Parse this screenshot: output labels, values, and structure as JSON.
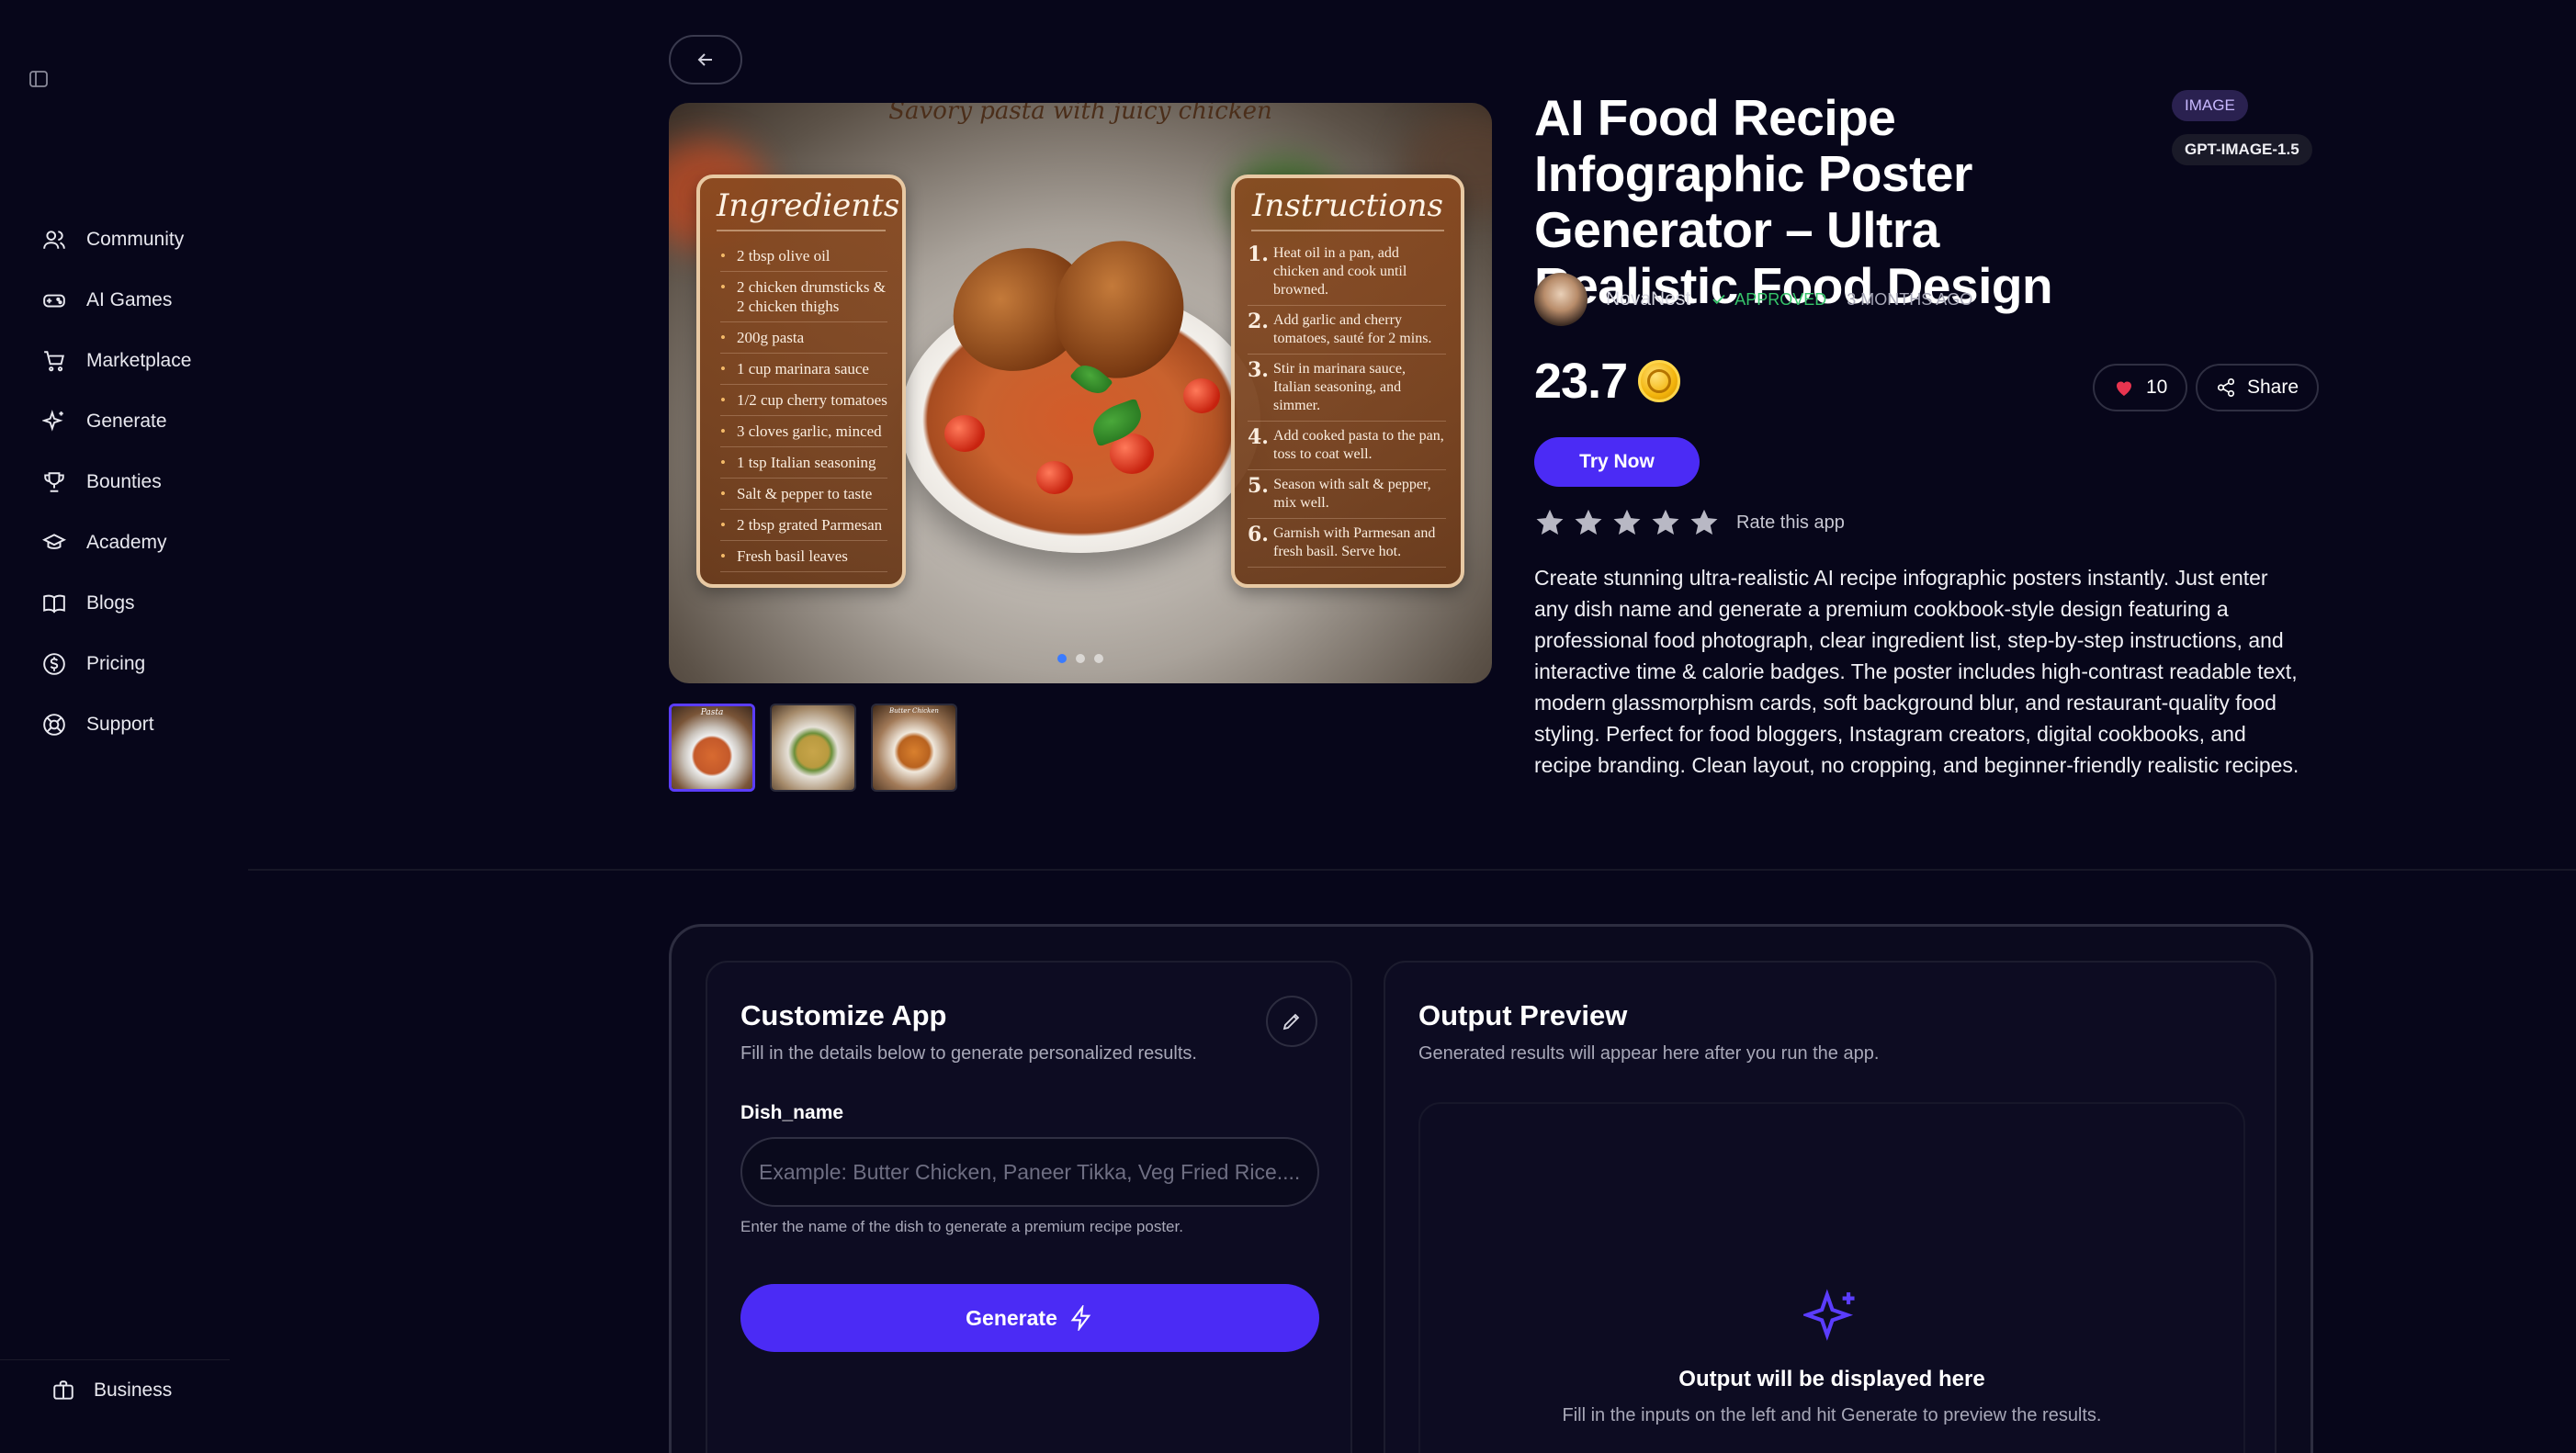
{
  "sidebar": {
    "items": [
      {
        "label": "Community",
        "icon": "users-icon"
      },
      {
        "label": "AI Games",
        "icon": "gamepad-icon"
      },
      {
        "label": "Marketplace",
        "icon": "cart-icon"
      },
      {
        "label": "Generate",
        "icon": "sparkle-icon"
      },
      {
        "label": "Bounties",
        "icon": "trophy-icon"
      },
      {
        "label": "Academy",
        "icon": "graduation-cap-icon"
      },
      {
        "label": "Blogs",
        "icon": "book-icon"
      },
      {
        "label": "Pricing",
        "icon": "dollar-circle-icon"
      },
      {
        "label": "Support",
        "icon": "lifebuoy-icon"
      }
    ],
    "business_label": "Business"
  },
  "poster": {
    "title": "Savory pasta with juicy chicken",
    "ingredients_heading": "Ingredients",
    "ingredients": [
      "2 tbsp olive oil",
      "2 chicken drumsticks & 2 chicken thighs",
      "200g pasta",
      "1 cup marinara sauce",
      "1/2 cup cherry tomatoes",
      "3 cloves garlic, minced",
      "1 tsp Italian seasoning",
      "Salt & pepper to taste",
      "2 tbsp grated Parmesan",
      "Fresh basil leaves"
    ],
    "instructions_heading": "Instructions",
    "instructions": [
      {
        "num": "1.",
        "text": "Heat oil in a pan, add chicken and cook until browned."
      },
      {
        "num": "2.",
        "text": "Add garlic and cherry tomatoes, sauté for 2 mins."
      },
      {
        "num": "3.",
        "text": "Stir in marinara sauce, Italian seasoning, and simmer."
      },
      {
        "num": "4.",
        "text": "Add cooked pasta to the pan, toss to coat well."
      },
      {
        "num": "5.",
        "text": "Season with salt & pepper, mix well."
      },
      {
        "num": "6.",
        "text": "Garnish with Parmesan and fresh basil. Serve hot."
      }
    ],
    "thumb_labels": [
      "Pasta",
      "",
      "Butter Chicken"
    ]
  },
  "app": {
    "title": "AI Food Recipe Infographic Poster Generator – Ultra Realistic Food Design",
    "tags": [
      "IMAGE",
      "GPT-IMAGE-1.5"
    ],
    "author": "NovaNest",
    "status": "APPROVED",
    "age": "3 MONTHS AGO",
    "price": "23.7",
    "likes": "10",
    "share_label": "Share",
    "try_label": "Try Now",
    "rating_stars": 5,
    "rate_label": "Rate this app",
    "description": "Create stunning ultra-realistic AI recipe infographic posters instantly. Just enter any dish name and generate a premium cookbook-style design featuring a professional food photograph, clear ingredient list, step-by-step instructions, and interactive time & calorie badges. The poster includes high-contrast readable text, modern glassmorphism cards, soft background blur, and restaurant-quality food styling. Perfect for food bloggers, Instagram creators, digital cookbooks, and recipe branding. Clean layout, no cropping, and beginner-friendly realistic recipes."
  },
  "customize": {
    "title": "Customize App",
    "subtitle": "Fill in the details below to generate personalized results.",
    "field_label": "Dish_name",
    "field_placeholder": "Example: Butter Chicken, Paneer Tikka, Veg Fried Rice.......",
    "field_hint": "Enter the name of the dish to generate a premium recipe poster.",
    "generate_label": "Generate"
  },
  "output": {
    "title": "Output Preview",
    "subtitle": "Generated results will appear here after you run the app.",
    "empty_title": "Output will be displayed here",
    "empty_sub": "Fill in the inputs on the left and hit Generate to preview the results."
  },
  "colors": {
    "accent": "#4b2bf5",
    "approved": "#36c46a",
    "background": "#07061a"
  }
}
